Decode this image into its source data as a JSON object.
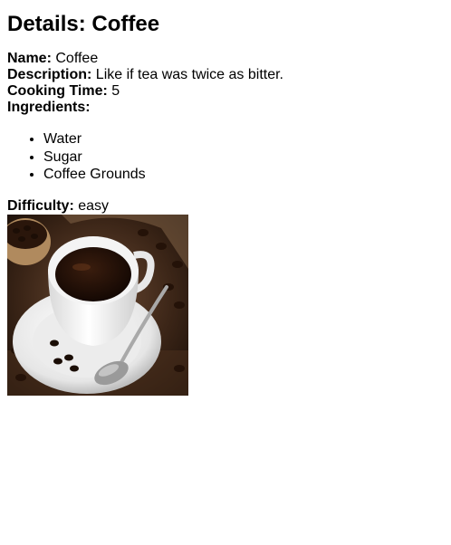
{
  "page": {
    "title": "Details: Coffee"
  },
  "details": {
    "name_label": "Name:",
    "name_value": "Coffee",
    "description_label": "Description:",
    "description_value": "Like if tea was twice as bitter.",
    "cooking_time_label": "Cooking Time:",
    "cooking_time_value": "5",
    "ingredients_label": "Ingredients:",
    "ingredients": [
      "Water",
      "Sugar",
      "Coffee Grounds"
    ],
    "difficulty_label": "Difficulty:",
    "difficulty_value": "easy"
  },
  "image": {
    "subject": "cup of black coffee on saucer with spoon and coffee beans"
  },
  "colors": {
    "background": "#ffffff",
    "text": "#000000"
  }
}
